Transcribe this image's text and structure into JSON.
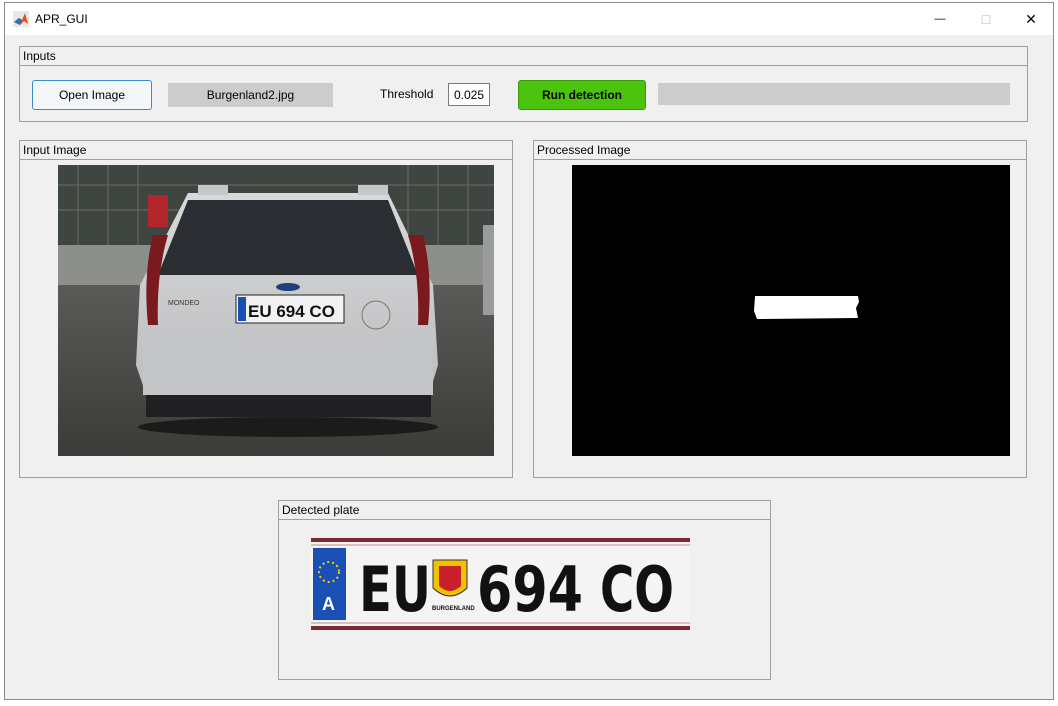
{
  "window": {
    "title": "APR_GUI"
  },
  "titlebar": {
    "minimize": "—",
    "maximize": "□",
    "close": "✕"
  },
  "inputs": {
    "panel_title": "Inputs",
    "open_label": "Open Image",
    "filename": "Burgenland2.jpg",
    "threshold_label": "Threshold",
    "threshold_value": "0.025",
    "run_label": "Run detection",
    "progress": 0
  },
  "input_image": {
    "panel_title": "Input Image",
    "plate_text": "EU 694 CO",
    "car_badge": "MONDEO"
  },
  "processed_image": {
    "panel_title": "Processed Image"
  },
  "detected_plate": {
    "panel_title": "Detected plate",
    "country": "A",
    "prefix": "EU",
    "number": "694",
    "suffix": "CO",
    "region": "BURGENLAND"
  },
  "colors": {
    "run_button": "#4cc40d",
    "eu_band": "#1a4fb3",
    "accent": "#3c8ad4"
  }
}
